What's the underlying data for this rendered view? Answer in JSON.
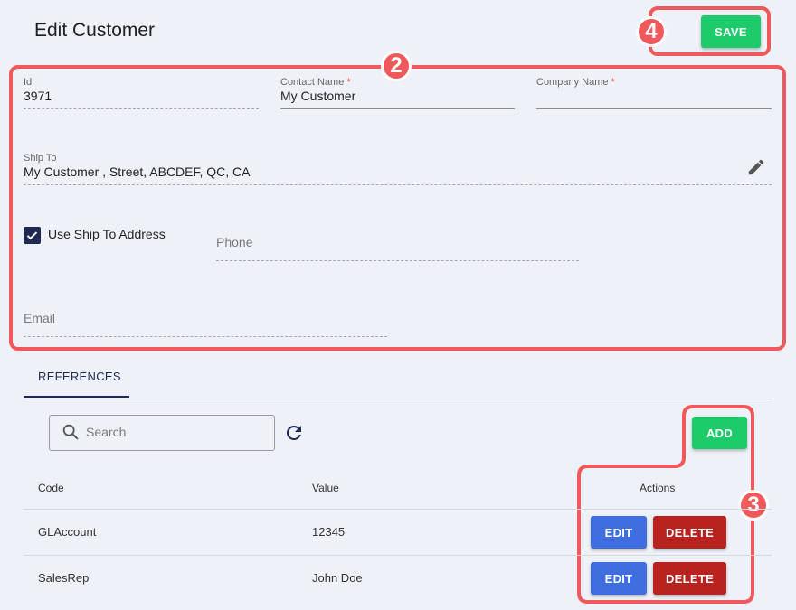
{
  "page": {
    "title": "Edit Customer"
  },
  "toolbar": {
    "save_label": "SAVE"
  },
  "annotations": {
    "form": "2",
    "actions": "3",
    "save": "4"
  },
  "form": {
    "id": {
      "label": "Id",
      "value": "3971"
    },
    "contact_name": {
      "label": "Contact Name",
      "required": "*",
      "value": "My Customer"
    },
    "company_name": {
      "label": "Company Name",
      "required": "*",
      "value": ""
    },
    "ship_to": {
      "label": "Ship To",
      "value": "My Customer , Street, ABCDEF, QC, CA"
    },
    "use_ship_to": {
      "label": "Use Ship To Address",
      "checked": true
    },
    "phone": {
      "placeholder": "Phone"
    },
    "email": {
      "placeholder": "Email"
    }
  },
  "tabs": [
    {
      "label": "REFERENCES",
      "active": true
    }
  ],
  "references": {
    "search_placeholder": "Search",
    "add_label": "ADD",
    "columns": {
      "code": "Code",
      "value": "Value",
      "actions": "Actions"
    },
    "rows": [
      {
        "code": "GLAccount",
        "value": "12345"
      },
      {
        "code": "SalesRep",
        "value": "John Doe"
      }
    ],
    "edit_label": "EDIT",
    "delete_label": "DELETE"
  },
  "colors": {
    "accent_green": "#1dcb6a",
    "edit_blue": "#3f6ee0",
    "delete_red": "#b8231f",
    "annotation": "#f0595b",
    "navy": "#1e2a54"
  }
}
